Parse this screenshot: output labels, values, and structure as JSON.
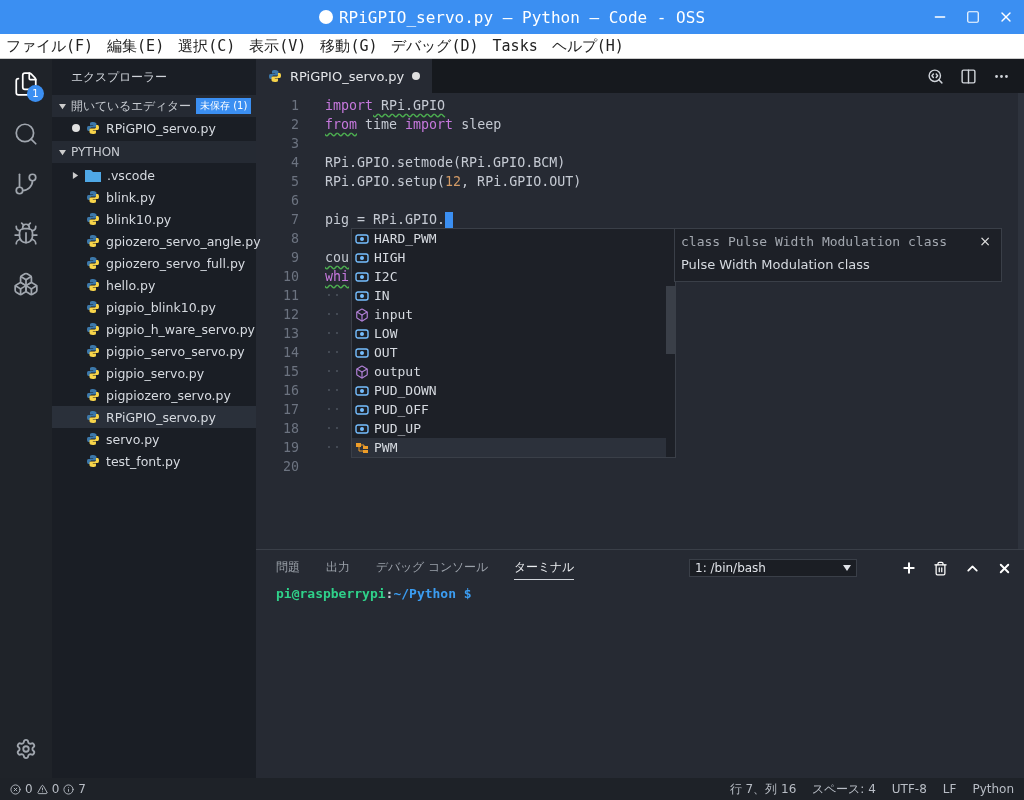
{
  "window": {
    "title": "RPiGPIO_servo.py — Python — Code - OSS",
    "unsaved": true
  },
  "menu": [
    "ファイル(F)",
    "編集(E)",
    "選択(C)",
    "表示(V)",
    "移動(G)",
    "デバッグ(D)",
    "Tasks",
    "ヘルプ(H)"
  ],
  "activity_bar": [
    {
      "kind": "files",
      "selected": true,
      "badge": "1"
    },
    {
      "kind": "search",
      "selected": false
    },
    {
      "kind": "git",
      "selected": false
    },
    {
      "kind": "debug",
      "selected": false
    },
    {
      "kind": "extensions",
      "selected": false
    }
  ],
  "sidebar": {
    "title": "エクスプローラー",
    "open_editors": {
      "label": "開いているエディター",
      "badge": "未保存 (1)",
      "expanded": true,
      "items": [
        {
          "name": "RPiGPIO_servo.py",
          "unsaved": true
        }
      ]
    },
    "folder": {
      "label": "PYTHON",
      "expanded": true,
      "items": [
        {
          "name": ".vscode",
          "kind": "folder",
          "expanded": false,
          "selected": false
        },
        {
          "name": "blink.py",
          "kind": "python",
          "selected": false
        },
        {
          "name": "blink10.py",
          "kind": "python",
          "selected": false
        },
        {
          "name": "gpiozero_servo_angle.py",
          "kind": "python",
          "selected": false
        },
        {
          "name": "gpiozero_servo_full.py",
          "kind": "python",
          "selected": false
        },
        {
          "name": "hello.py",
          "kind": "python",
          "selected": false
        },
        {
          "name": "pigpio_blink10.py",
          "kind": "python",
          "selected": false
        },
        {
          "name": "pigpio_h_ware_servo.py",
          "kind": "python",
          "selected": false
        },
        {
          "name": "pigpio_servo_servo.py",
          "kind": "python",
          "selected": false
        },
        {
          "name": "pigpio_servo.py",
          "kind": "python",
          "selected": false
        },
        {
          "name": "pigpiozero_servo.py",
          "kind": "python",
          "selected": false
        },
        {
          "name": "RPiGPIO_servo.py",
          "kind": "python",
          "selected": true
        },
        {
          "name": "servo.py",
          "kind": "python",
          "selected": false
        },
        {
          "name": "test_font.py",
          "kind": "python",
          "selected": false
        }
      ]
    }
  },
  "editor": {
    "tab": {
      "name": "RPiGPIO_servo.py",
      "unsaved": true
    },
    "lines": [
      {
        "n": "1",
        "tokens": [
          {
            "text": "import",
            "kind": "keyword"
          },
          {
            "text": " RPi.GPIO",
            "kind": "plain",
            "warn": true
          }
        ]
      },
      {
        "n": "2",
        "tokens": [
          {
            "text": "from",
            "kind": "keyword",
            "warn": true
          },
          {
            "text": " time ",
            "kind": "plain"
          },
          {
            "text": "import",
            "kind": "keyword"
          },
          {
            "text": " sleep",
            "kind": "plain"
          }
        ]
      },
      {
        "n": "3"
      },
      {
        "n": "4",
        "tokens": [
          {
            "text": "RPi.GPIO.setmode(RPi.GPIO.BCM)",
            "kind": "plain"
          }
        ]
      },
      {
        "n": "5",
        "tokens": [
          {
            "text": "RPi.GPIO.setup(",
            "kind": "plain"
          },
          {
            "text": "12",
            "kind": "number"
          },
          {
            "text": ", RPi.GPIO.OUT)",
            "kind": "plain"
          }
        ]
      },
      {
        "n": "6"
      },
      {
        "n": "7",
        "tokens": [
          {
            "text": "pig = RPi.GPIO.",
            "kind": "plain"
          }
        ],
        "cursor": true
      },
      {
        "n": "8"
      },
      {
        "n": "9",
        "tokens": [
          {
            "text": "cou",
            "kind": "plain",
            "warn": true
          }
        ]
      },
      {
        "n": "10",
        "tokens": [
          {
            "text": "whi",
            "kind": "keyword",
            "warn": true
          }
        ]
      },
      {
        "n": "11",
        "tokens": [
          {
            "text": "··",
            "kind": "space"
          }
        ]
      },
      {
        "n": "12",
        "tokens": [
          {
            "text": "··",
            "kind": "space"
          }
        ]
      },
      {
        "n": "13",
        "tokens": [
          {
            "text": "··",
            "kind": "space"
          }
        ]
      },
      {
        "n": "14",
        "tokens": [
          {
            "text": "··",
            "kind": "space"
          }
        ]
      },
      {
        "n": "15",
        "tokens": [
          {
            "text": "··",
            "kind": "space"
          }
        ]
      },
      {
        "n": "16",
        "tokens": [
          {
            "text": "··",
            "kind": "space"
          }
        ]
      },
      {
        "n": "17",
        "tokens": [
          {
            "text": "··",
            "kind": "space"
          }
        ]
      },
      {
        "n": "18",
        "tokens": [
          {
            "text": "··",
            "kind": "space"
          }
        ]
      },
      {
        "n": "19",
        "tokens": [
          {
            "text": "··",
            "kind": "space"
          }
        ]
      },
      {
        "n": "20"
      }
    ],
    "suggestions": [
      {
        "label": "HARD_PWM",
        "kind": "field",
        "selected": false
      },
      {
        "label": "HIGH",
        "kind": "field",
        "selected": false
      },
      {
        "label": "I2C",
        "kind": "field",
        "selected": false
      },
      {
        "label": "IN",
        "kind": "field",
        "selected": false
      },
      {
        "label": "input",
        "kind": "module",
        "selected": false
      },
      {
        "label": "LOW",
        "kind": "field",
        "selected": false
      },
      {
        "label": "OUT",
        "kind": "field",
        "selected": false
      },
      {
        "label": "output",
        "kind": "module",
        "selected": false
      },
      {
        "label": "PUD_DOWN",
        "kind": "field",
        "selected": false
      },
      {
        "label": "PUD_OFF",
        "kind": "field",
        "selected": false
      },
      {
        "label": "PUD_UP",
        "kind": "field",
        "selected": false
      },
      {
        "label": "PWM",
        "kind": "class",
        "selected": true
      }
    ],
    "details": {
      "signature": "class Pulse Width Modulation class",
      "close": "×",
      "doc": "Pulse Width Modulation class"
    }
  },
  "panel": {
    "tabs": [
      {
        "label": "問題",
        "selected": false
      },
      {
        "label": "出力",
        "selected": false
      },
      {
        "label": "デバッグ コンソール",
        "selected": false
      },
      {
        "label": "ターミナル",
        "selected": true
      }
    ],
    "terminal_select": "1: /bin/bash",
    "prompt": {
      "user": "pi@raspberrypi",
      "sep": ":",
      "path": "~/Python $"
    }
  },
  "status_bar": {
    "errors": "0",
    "warnings": "0",
    "infos": "7",
    "items": [
      "行 7、列 16",
      "スペース: 4",
      "UTF-8",
      "LF",
      "Python"
    ]
  }
}
